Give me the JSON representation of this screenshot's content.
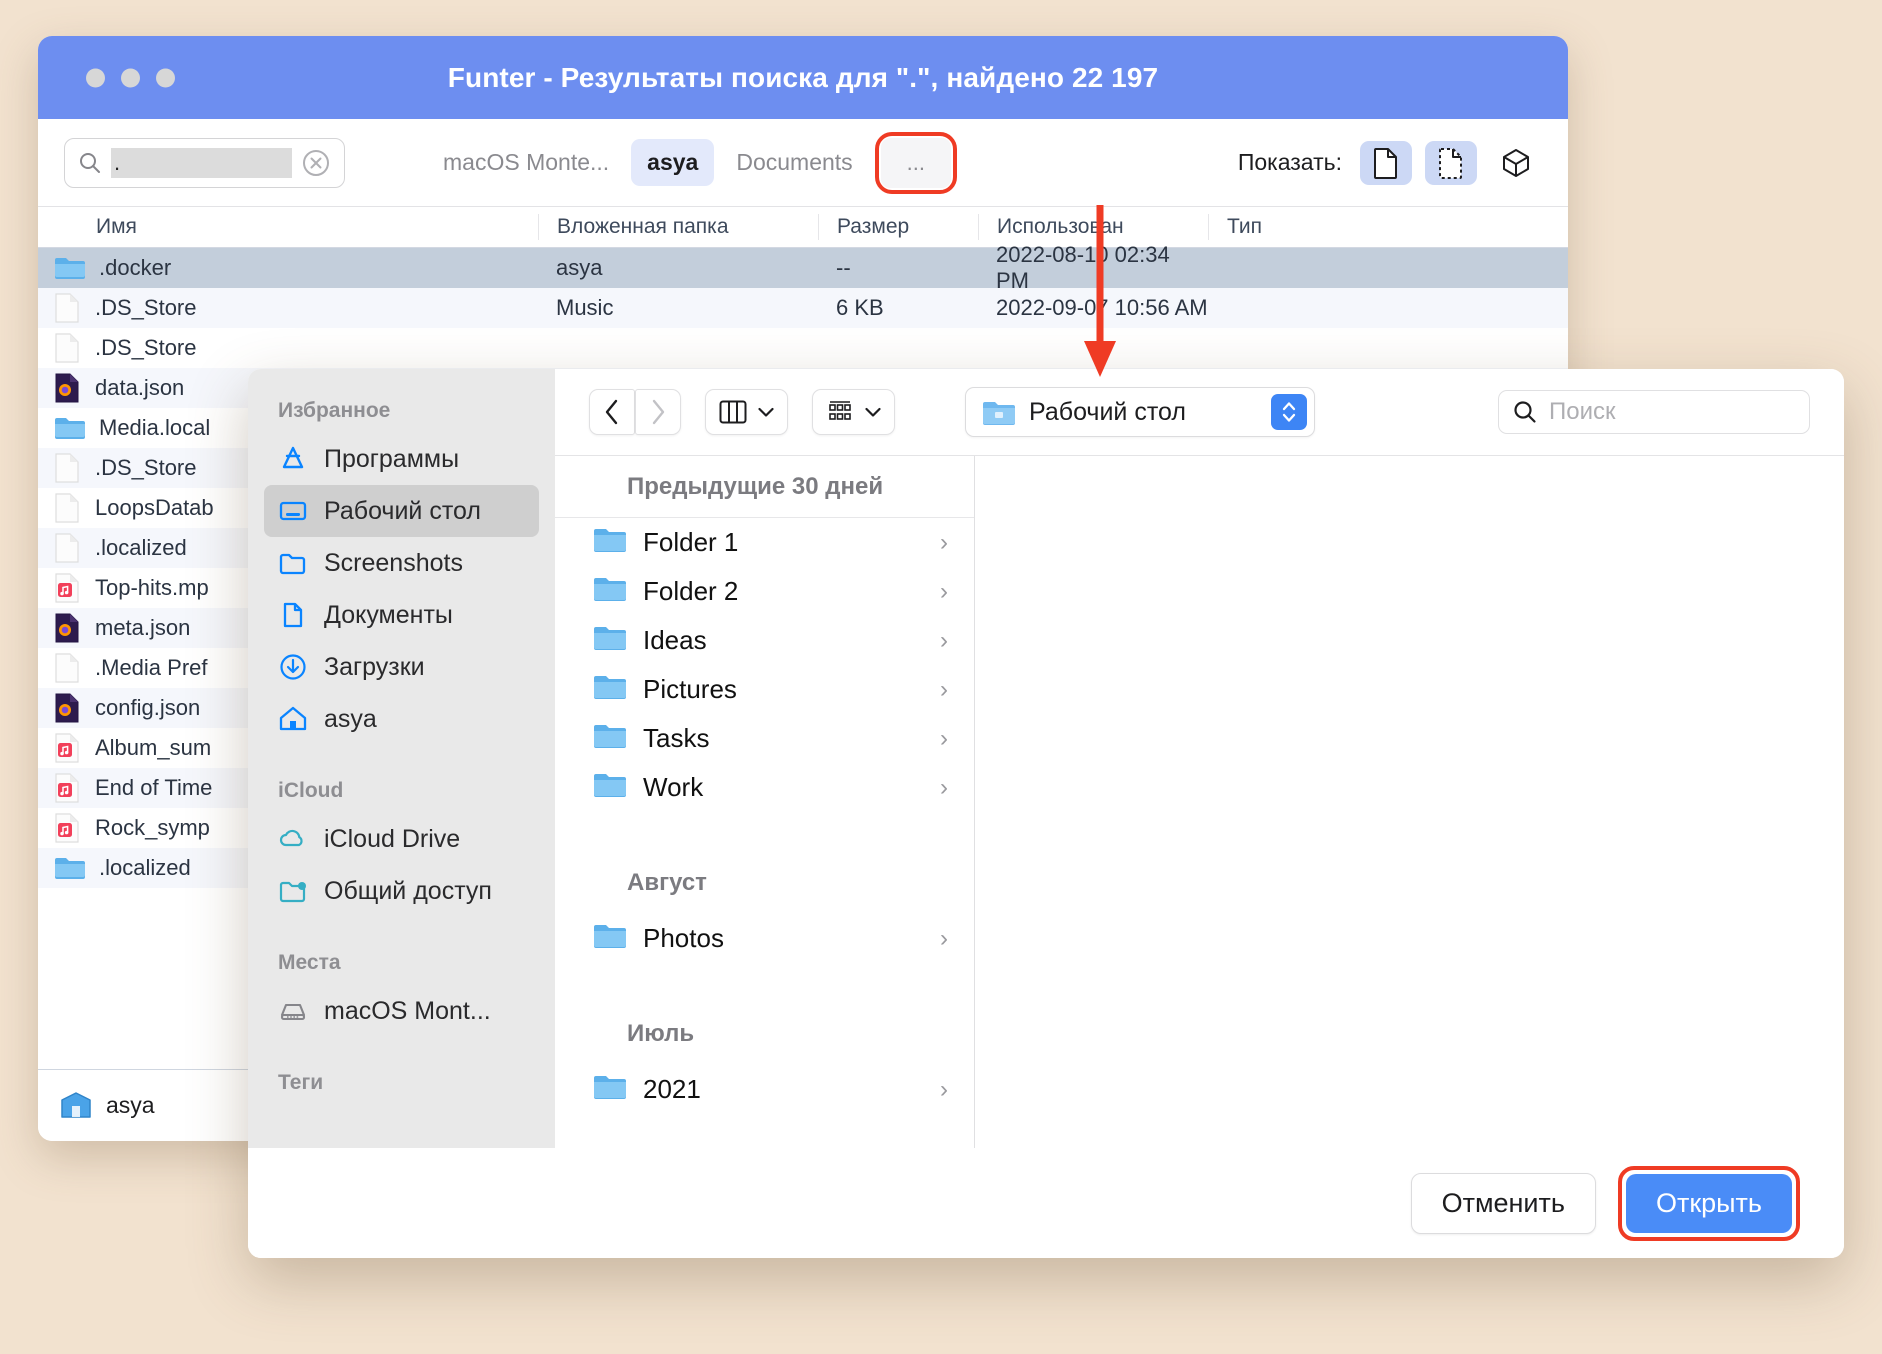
{
  "funter": {
    "title": "Funter - Результаты поиска для \".\", найдено 22 197",
    "search": {
      "value": ".",
      "placeholder": ""
    },
    "crumbs": [
      {
        "label": "macOS Monte...",
        "active": false
      },
      {
        "label": "asya",
        "active": true
      },
      {
        "label": "Documents",
        "active": false
      },
      {
        "label": "...",
        "active": false,
        "highlighted": true
      }
    ],
    "show_label": "Показать:",
    "view_buttons": [
      {
        "icon": "file-icon",
        "on": true
      },
      {
        "icon": "hidden-file-icon",
        "on": true
      },
      {
        "icon": "package-cube-icon",
        "on": false
      }
    ],
    "columns": [
      "Имя",
      "Вложенная папка",
      "Размер",
      "Использован",
      "Тип"
    ],
    "rows": [
      {
        "name": ".docker",
        "icon": "folder-icon",
        "folder": "asya",
        "size": "--",
        "used": "2022-08-10 02:34 PM",
        "type": "",
        "selected": true
      },
      {
        "name": ".DS_Store",
        "icon": "file-icon",
        "folder": "Music",
        "size": "6 KB",
        "used": "2022-09-07 10:56 AM",
        "type": "",
        "selected": false
      },
      {
        "name": ".DS_Store",
        "icon": "file-icon",
        "folder": "",
        "size": "",
        "used": "",
        "type": "",
        "selected": false
      },
      {
        "name": "data.json",
        "icon": "firefox-icon",
        "folder": "",
        "size": "",
        "used": "",
        "type": "",
        "selected": false
      },
      {
        "name": "Media.local",
        "icon": "folder-icon",
        "folder": "",
        "size": "",
        "used": "",
        "type": "",
        "selected": false
      },
      {
        "name": ".DS_Store",
        "icon": "file-icon",
        "folder": "",
        "size": "",
        "used": "",
        "type": "",
        "selected": false
      },
      {
        "name": "LoopsDatab",
        "icon": "file-icon",
        "folder": "",
        "size": "",
        "used": "",
        "type": "",
        "selected": false
      },
      {
        "name": ".localized",
        "icon": "file-icon",
        "folder": "",
        "size": "",
        "used": "",
        "type": "",
        "selected": false
      },
      {
        "name": "Top-hits.mp",
        "icon": "music-icon",
        "folder": "",
        "size": "",
        "used": "",
        "type": "",
        "selected": false
      },
      {
        "name": "meta.json",
        "icon": "firefox-icon",
        "folder": "",
        "size": "",
        "used": "",
        "type": "",
        "selected": false
      },
      {
        "name": ".Media Pref",
        "icon": "file-icon",
        "folder": "",
        "size": "",
        "used": "",
        "type": "",
        "selected": false
      },
      {
        "name": "config.json",
        "icon": "firefox-icon",
        "folder": "",
        "size": "",
        "used": "",
        "type": "",
        "selected": false
      },
      {
        "name": "Album_sum",
        "icon": "music-icon",
        "folder": "",
        "size": "",
        "used": "",
        "type": "",
        "selected": false
      },
      {
        "name": "End of Time",
        "icon": "music-icon",
        "folder": "",
        "size": "",
        "used": "",
        "type": "",
        "selected": false
      },
      {
        "name": "Rock_symp",
        "icon": "music-icon",
        "folder": "",
        "size": "",
        "used": "",
        "type": "",
        "selected": false
      },
      {
        "name": ".localized",
        "icon": "folder-icon",
        "folder": "",
        "size": "",
        "used": "",
        "type": "",
        "selected": false
      }
    ],
    "status_path": "asya"
  },
  "dialog": {
    "sidebar": {
      "sections": [
        {
          "header": "Избранное",
          "items": [
            {
              "label": "Программы",
              "icon": "applications-icon",
              "active": false
            },
            {
              "label": "Рабочий стол",
              "icon": "desktop-icon",
              "active": true
            },
            {
              "label": "Screenshots",
              "icon": "folder-outline-icon",
              "active": false
            },
            {
              "label": "Документы",
              "icon": "document-icon",
              "active": false
            },
            {
              "label": "Загрузки",
              "icon": "downloads-icon",
              "active": false
            },
            {
              "label": "asya",
              "icon": "home-icon",
              "active": false
            }
          ]
        },
        {
          "header": "iCloud",
          "items": [
            {
              "label": "iCloud Drive",
              "icon": "cloud-icon",
              "active": false
            },
            {
              "label": "Общий доступ",
              "icon": "shared-folder-icon",
              "active": false
            }
          ]
        },
        {
          "header": "Места",
          "items": [
            {
              "label": "macOS Mont...",
              "icon": "drive-icon",
              "active": false
            }
          ]
        },
        {
          "header": "Теги",
          "items": []
        }
      ]
    },
    "toolbar": {
      "back_icon": "chevron-left-icon",
      "forward_icon": "chevron-right-icon",
      "view_icon": "column-view-icon",
      "group_icon": "group-view-icon",
      "path_label": "Рабочий стол",
      "path_icon": "folder-icon",
      "search_placeholder": "Поиск"
    },
    "groups": [
      {
        "header": "Предыдущие 30 дней",
        "items": [
          {
            "name": "Folder 1",
            "icon": "folder-icon"
          },
          {
            "name": "Folder 2",
            "icon": "folder-icon"
          },
          {
            "name": "Ideas",
            "icon": "folder-icon"
          },
          {
            "name": "Pictures",
            "icon": "folder-icon"
          },
          {
            "name": "Tasks",
            "icon": "folder-icon"
          },
          {
            "name": "Work",
            "icon": "folder-icon"
          }
        ]
      },
      {
        "header": "Август",
        "items": [
          {
            "name": "Photos",
            "icon": "folder-icon"
          }
        ]
      },
      {
        "header": "Июль",
        "items": [
          {
            "name": "2021",
            "icon": "folder-icon"
          }
        ]
      }
    ],
    "footer": {
      "cancel_label": "Отменить",
      "open_label": "Открыть"
    }
  },
  "annotation": {
    "accent_color": "#ef3b24",
    "arrow": "down-arrow"
  }
}
